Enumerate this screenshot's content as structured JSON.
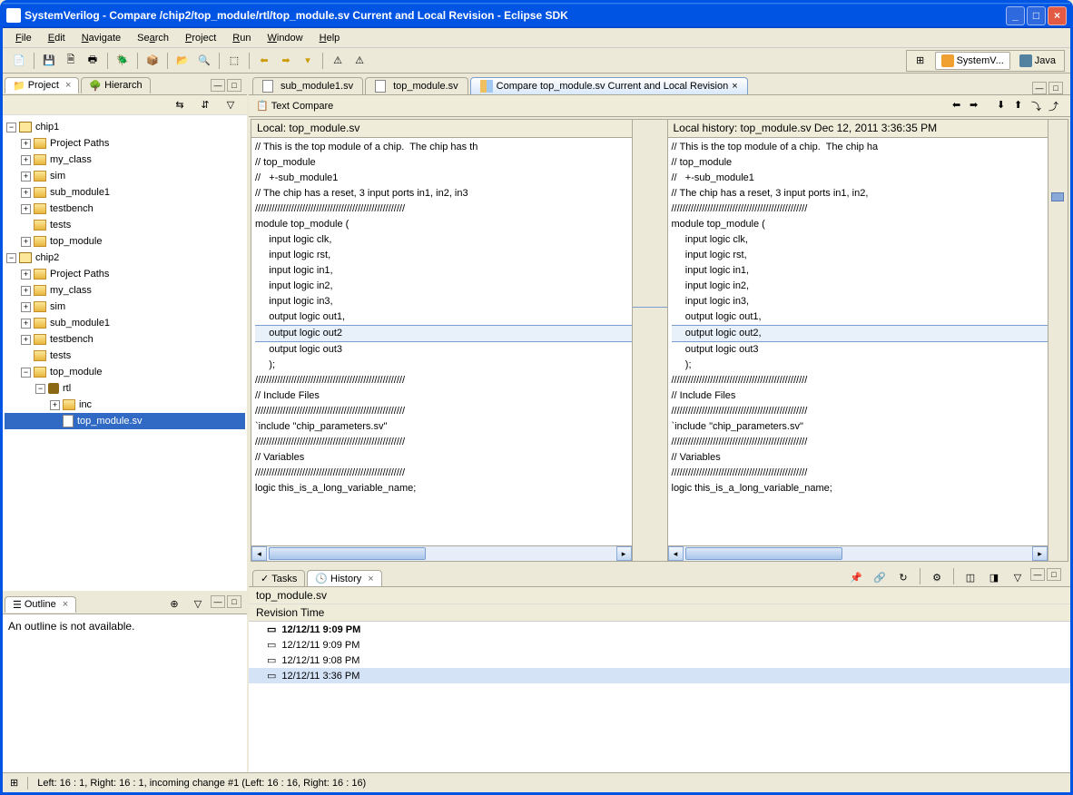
{
  "window": {
    "title": "SystemVerilog - Compare /chip2/top_module/rtl/top_module.sv Current and Local Revision - Eclipse SDK"
  },
  "menu": {
    "file": "File",
    "edit": "Edit",
    "navigate": "Navigate",
    "search": "Search",
    "project": "Project",
    "run": "Run",
    "window": "Window",
    "help": "Help"
  },
  "persp": {
    "sv": "SystemV...",
    "java": "Java"
  },
  "views": {
    "project": "Project",
    "hierarch": "Hierarch",
    "outline": "Outline",
    "outline_msg": "An outline is not available."
  },
  "tree": {
    "chip1": "chip1",
    "chip2": "chip2",
    "proj_paths": "Project Paths",
    "my_class": "my_class",
    "sim": "sim",
    "sub_module1": "sub_module1",
    "testbench": "testbench",
    "tests": "tests",
    "top_module": "top_module",
    "rtl": "rtl",
    "inc": "inc",
    "top_module_sv": "top_module.sv"
  },
  "editor_tabs": {
    "sub_module1": "sub_module1.sv",
    "top_module": "top_module.sv",
    "compare": "Compare top_module.sv Current and Local Revision"
  },
  "compare": {
    "text_compare": "Text Compare",
    "local_header": "Local: top_module.sv",
    "history_header": "Local history: top_module.sv Dec 12, 2011 3:36:35 PM",
    "left_lines": [
      "// This is the top module of a chip.  The chip has th",
      "// top_module",
      "//   +-sub_module1",
      "// The chip has a reset, 3 input ports in1, in2, in3",
      "//////////////////////////////////////////////////////",
      "module top_module (",
      "     input logic clk,",
      "     input logic rst,",
      "     input logic in1,",
      "     input logic in2,",
      "     input logic in3,",
      "     output logic out1,",
      "     output logic out2",
      "     output logic out3",
      "     );",
      "",
      "//////////////////////////////////////////////////////",
      "// Include Files",
      "//////////////////////////////////////////////////////",
      "`include \"chip_parameters.sv\"",
      "",
      "//////////////////////////////////////////////////////",
      "// Variables",
      "//////////////////////////////////////////////////////",
      "logic this_is_a_long_variable_name;"
    ],
    "right_lines": [
      "// This is the top module of a chip.  The chip ha",
      "// top_module",
      "//   +-sub_module1",
      "// The chip has a reset, 3 input ports in1, in2,",
      "/////////////////////////////////////////////////",
      "module top_module (",
      "     input logic clk,",
      "     input logic rst,",
      "     input logic in1,",
      "     input logic in2,",
      "     input logic in3,",
      "     output logic out1,",
      "     output logic out2,",
      "     output logic out3",
      "     );",
      "",
      "/////////////////////////////////////////////////",
      "// Include Files",
      "/////////////////////////////////////////////////",
      "`include \"chip_parameters.sv\"",
      "",
      "/////////////////////////////////////////////////",
      "// Variables",
      "/////////////////////////////////////////////////",
      "logic this_is_a_long_variable_name;"
    ],
    "diff_index": 12
  },
  "bottom": {
    "tasks": "Tasks",
    "history": "History",
    "file": "top_module.sv",
    "col": "Revision Time",
    "rows": [
      {
        "t": "12/12/11 9:09 PM",
        "bold": true
      },
      {
        "t": "12/12/11 9:09 PM",
        "bold": false
      },
      {
        "t": "12/12/11 9:08 PM",
        "bold": false
      },
      {
        "t": "12/12/11 3:36 PM",
        "bold": false
      }
    ]
  },
  "status": {
    "text": "Left: 16 : 1, Right: 16 : 1, incoming change #1 (Left: 16 : 16, Right: 16 : 16)"
  }
}
